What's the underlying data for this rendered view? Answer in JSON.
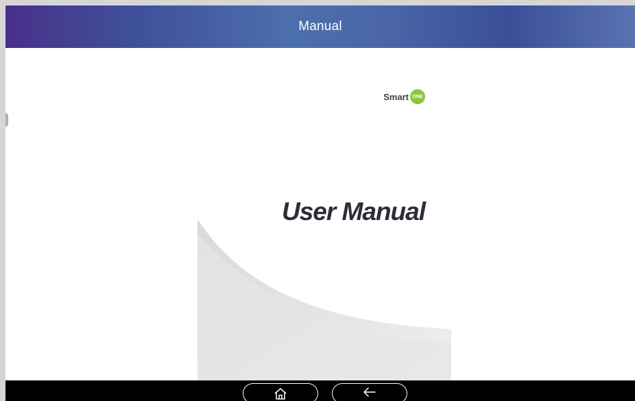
{
  "header": {
    "title": "Manual"
  },
  "document": {
    "logo": {
      "brand_text": "Smart",
      "badge_text": "ONE",
      "badge_color": "#8cc63f"
    },
    "cover_title": "User Manual"
  },
  "navigation": {
    "home_icon": "home-icon",
    "back_icon": "back-arrow-icon"
  },
  "colors": {
    "titlebar_accent": "#4c6fad",
    "nav_background": "#000000"
  }
}
